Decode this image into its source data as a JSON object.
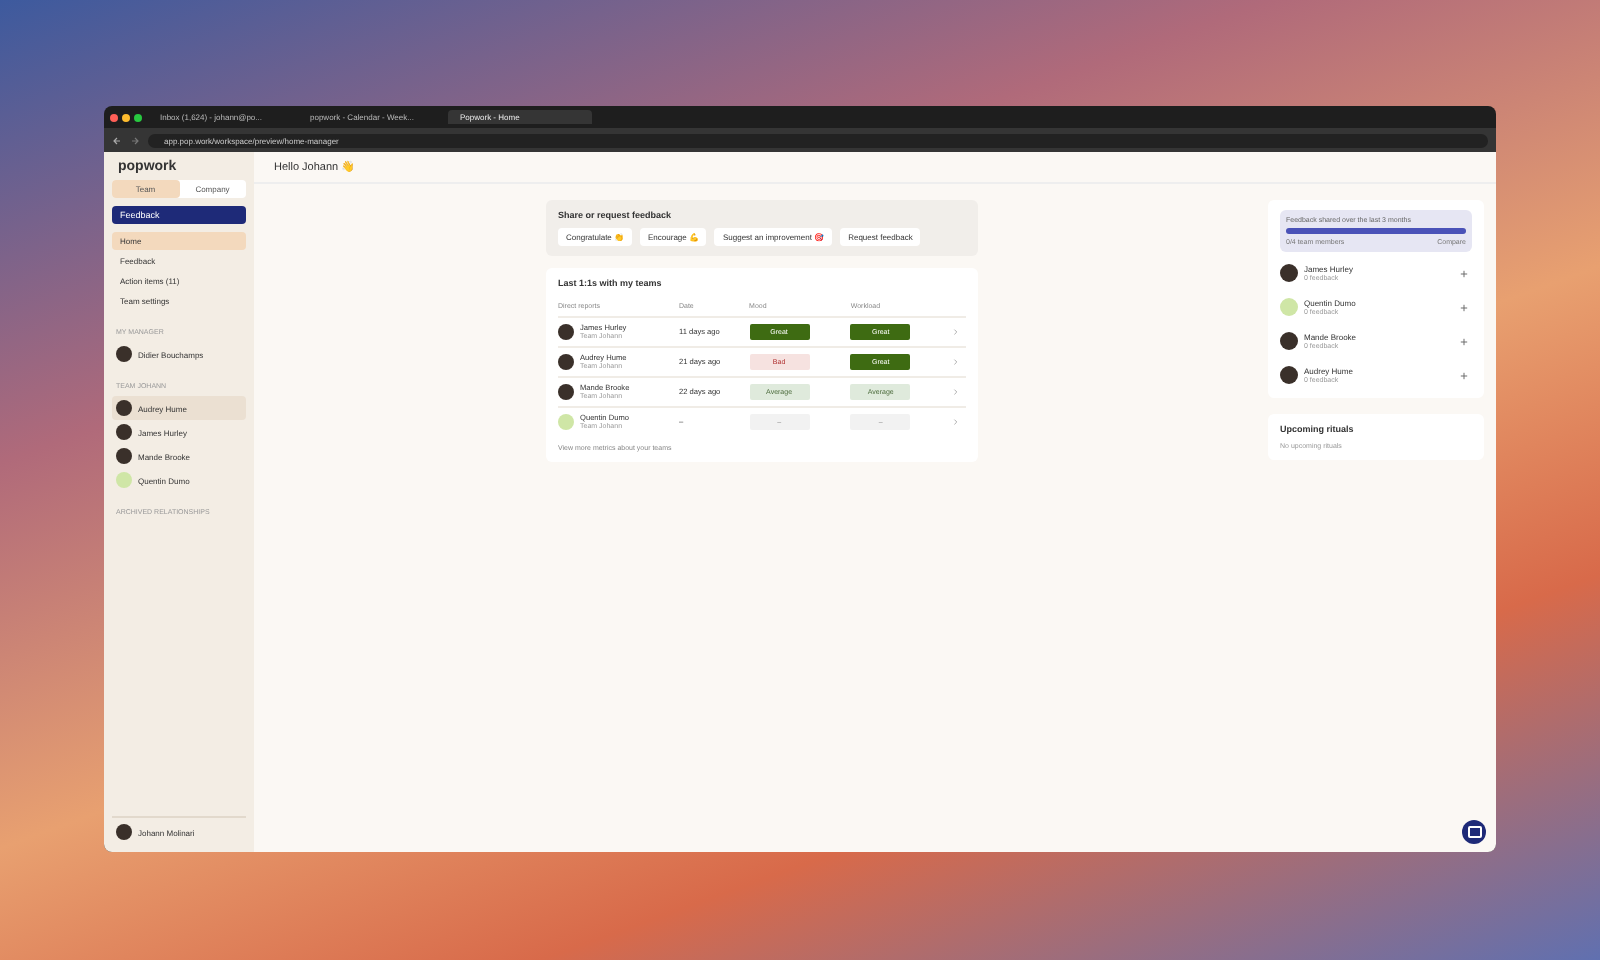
{
  "browser": {
    "tabs": [
      {
        "title": "Inbox (1,624) - johann@po...",
        "selected": false
      },
      {
        "title": "popwork - Calendar - Week...",
        "selected": false
      },
      {
        "title": "Popwork - Home",
        "selected": true
      }
    ],
    "url": "app.pop.work/workspace/preview/home-manager"
  },
  "sidebar": {
    "logo": "popwork",
    "scope_toggle": [
      {
        "label": "Team",
        "selected": true
      },
      {
        "label": "Company",
        "selected": false
      }
    ],
    "feedback_button": "Feedback",
    "nav": [
      {
        "label": "Home",
        "selected": true
      },
      {
        "label": "Feedback",
        "selected": false
      },
      {
        "label": "Action items (11)",
        "selected": false
      },
      {
        "label": "Team settings",
        "selected": false
      }
    ],
    "manager_heading": "MY MANAGER",
    "manager": {
      "name": "Didier Bouchamps"
    },
    "team_heading": "TEAM JOHANN",
    "team": [
      {
        "name": "Audrey Hume",
        "hovered": true
      },
      {
        "name": "James Hurley",
        "hovered": false
      },
      {
        "name": "Mande Brooke",
        "hovered": false
      },
      {
        "name": "Quentin Dumo",
        "hovered": false
      }
    ],
    "archived_heading": "ARCHIVED RELATIONSHIPS",
    "user": {
      "name": "Johann Molinari"
    }
  },
  "header": {
    "greeting": "Hello Johann 👋"
  },
  "feedback_card": {
    "title": "Share or request feedback",
    "actions": [
      "Congratulate 👏",
      "Encourage 💪",
      "Suggest an improvement 🎯",
      "Request feedback"
    ]
  },
  "one_on_ones": {
    "title": "Last 1:1s with my teams",
    "columns": [
      "Direct reports",
      "Date",
      "Mood",
      "Workload"
    ],
    "rows": [
      {
        "name": "James Hurley",
        "team": "Team Johann",
        "date": "11 days ago",
        "mood": {
          "kind": "great",
          "label": "Great"
        },
        "workload": {
          "kind": "great",
          "label": "Great"
        }
      },
      {
        "name": "Audrey Hume",
        "team": "Team Johann",
        "date": "21 days ago",
        "mood": {
          "kind": "bad",
          "label": "Bad"
        },
        "workload": {
          "kind": "great",
          "label": "Great"
        }
      },
      {
        "name": "Mande Brooke",
        "team": "Team Johann",
        "date": "22 days ago",
        "mood": {
          "kind": "average",
          "label": "Average"
        },
        "workload": {
          "kind": "average",
          "label": "Average"
        }
      },
      {
        "name": "Quentin Dumo",
        "team": "Team Johann",
        "date": "–",
        "mood": {
          "kind": "none",
          "label": "–"
        },
        "workload": {
          "kind": "none",
          "label": "–"
        }
      }
    ],
    "footer_link": "View more metrics about your teams"
  },
  "feedback_stats": {
    "title": "Feedback shared over the last 3 months",
    "level": 1,
    "members": "0/4 team members",
    "compare": "Compare",
    "people": [
      {
        "name": "James Hurley",
        "count": "0 feedback"
      },
      {
        "name": "Quentin Dumo",
        "count": "0 feedback"
      },
      {
        "name": "Mande Brooke",
        "count": "0 feedback"
      },
      {
        "name": "Audrey Hume",
        "count": "0 feedback"
      }
    ]
  },
  "rituals": {
    "title": "Upcoming rituals",
    "empty": "No upcoming rituals"
  }
}
